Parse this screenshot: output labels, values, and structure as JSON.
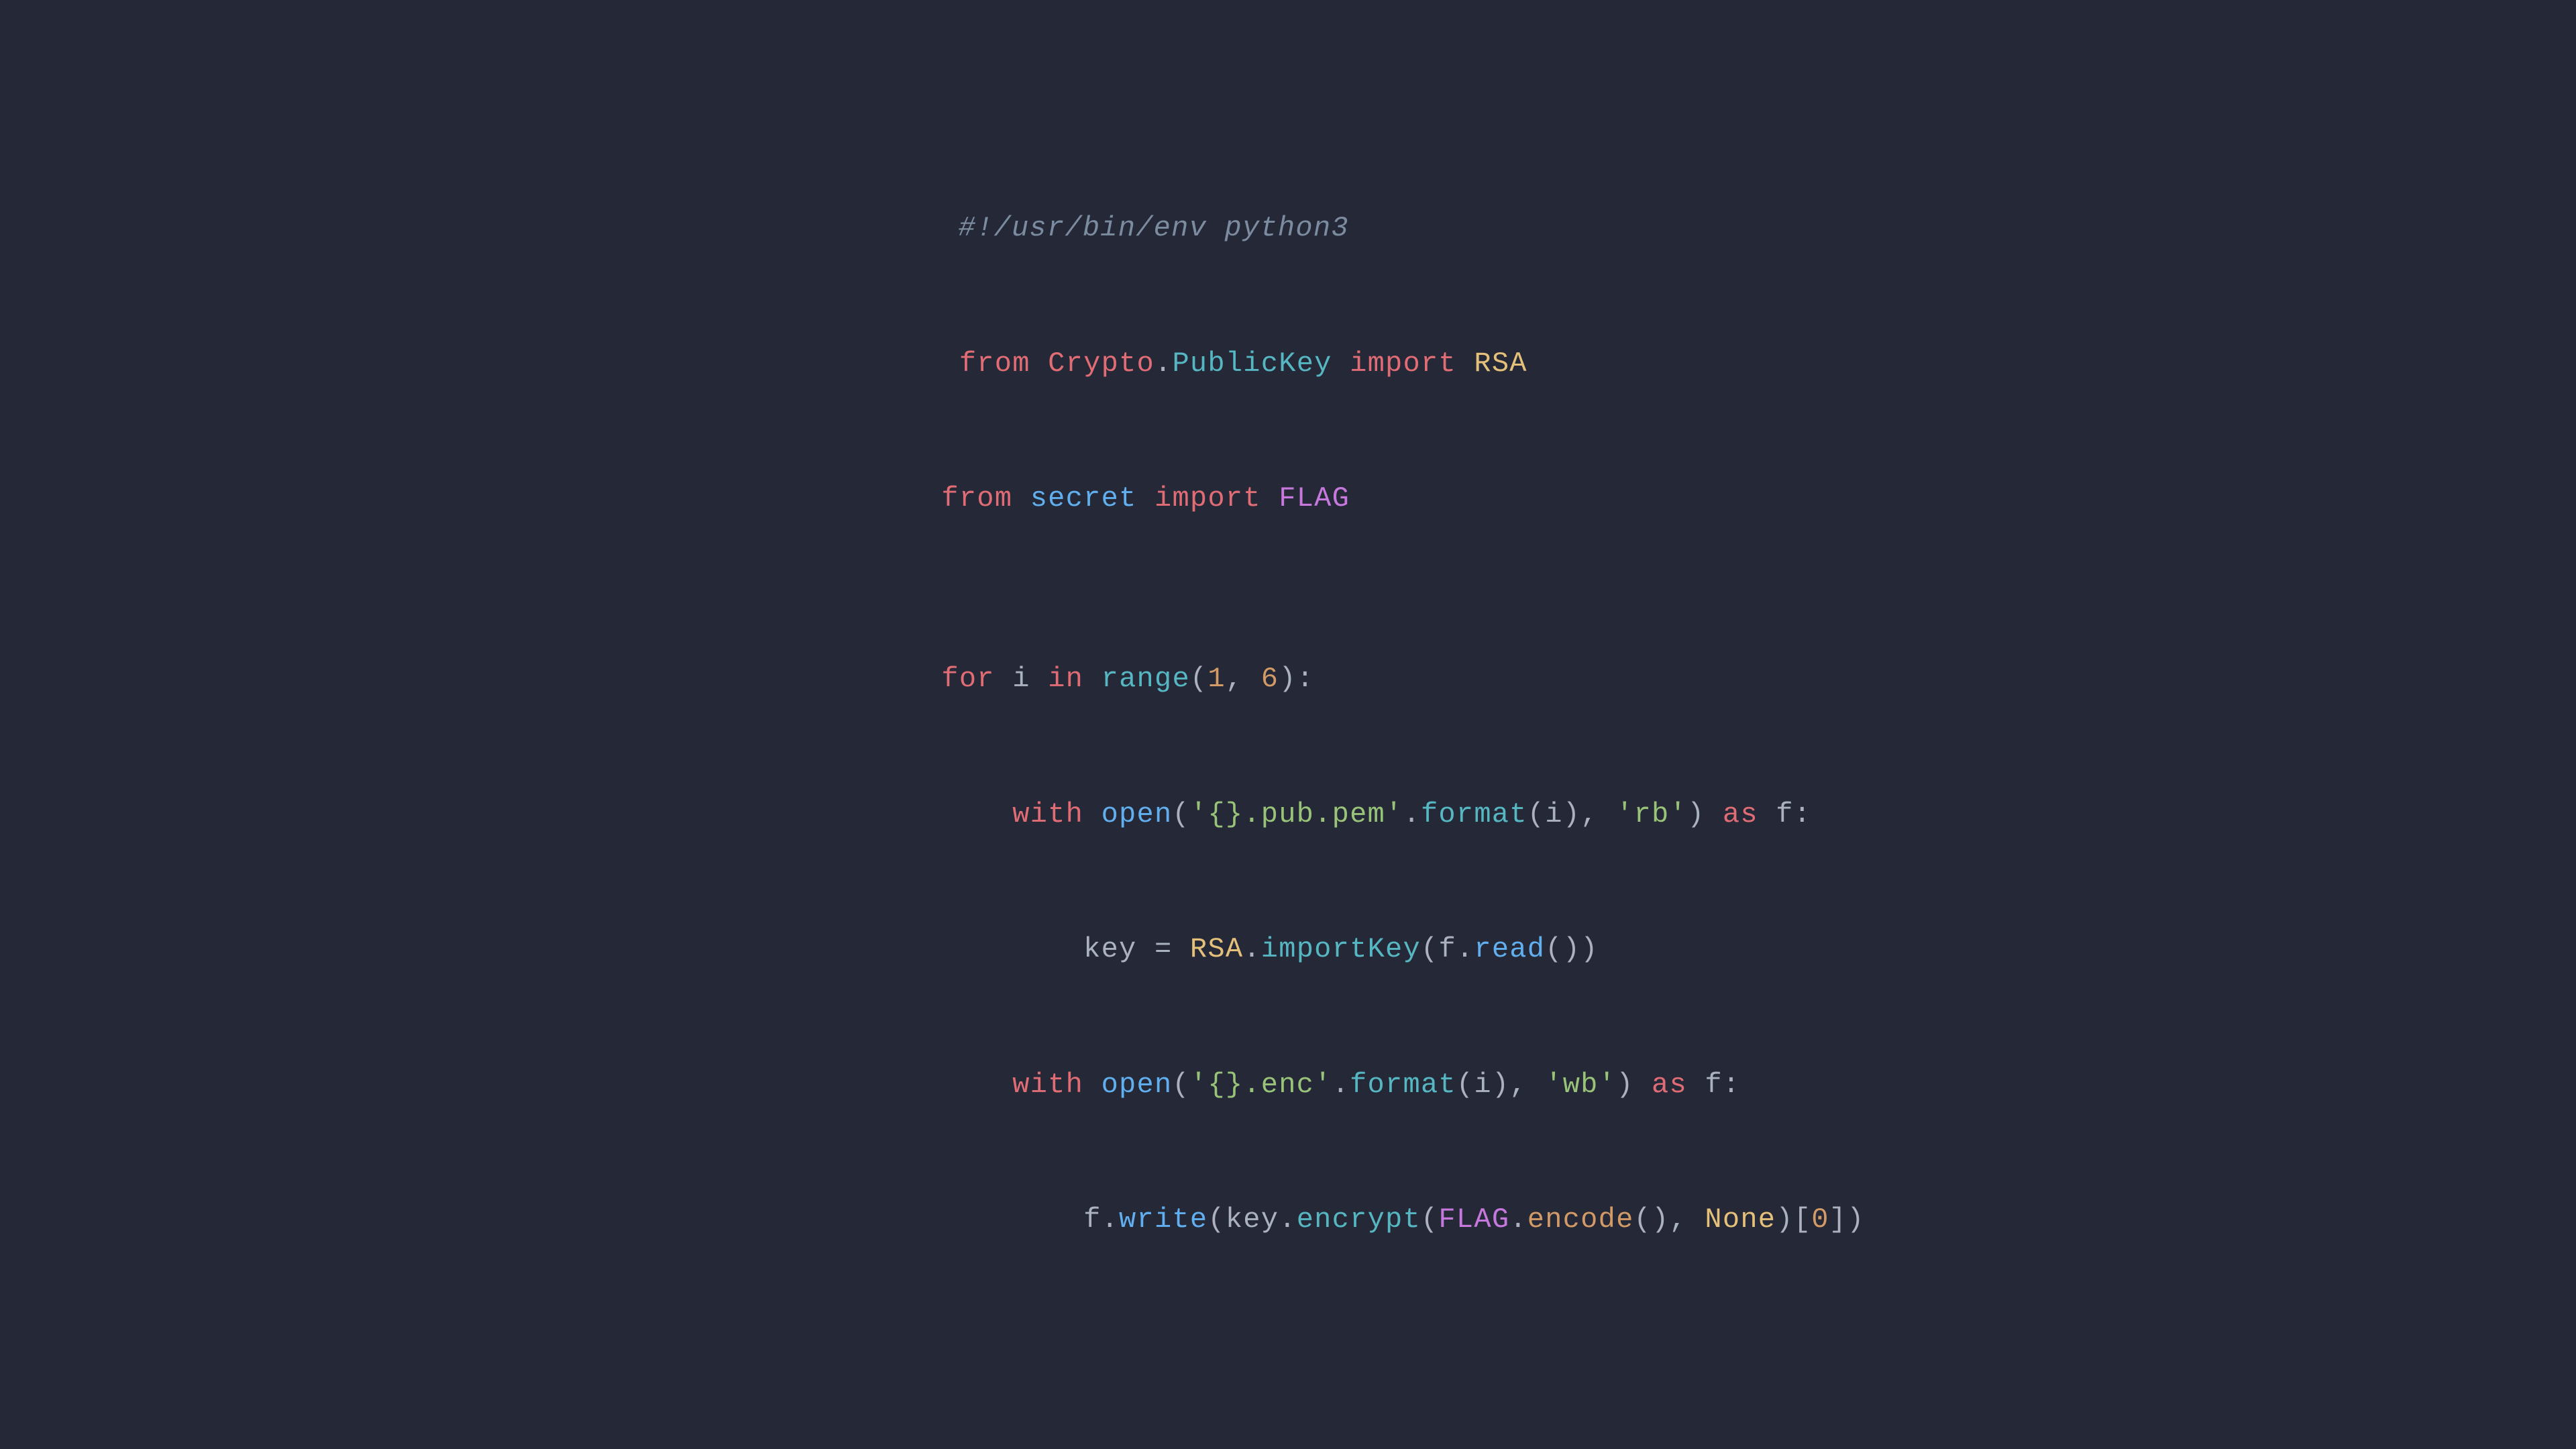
{
  "background": "#252836",
  "code": {
    "lines": [
      {
        "id": "shebang",
        "text": "#!/usr/bin/env python3"
      },
      {
        "id": "import1",
        "text": "from Crypto.PublicKey import RSA"
      },
      {
        "id": "import2",
        "text": "from secret import FLAG"
      },
      {
        "id": "empty1",
        "text": ""
      },
      {
        "id": "forloop",
        "text": "for i in range(1, 6):"
      },
      {
        "id": "with1",
        "text": "    with open('{}.pub.pem'.format(i), 'rb') as f:"
      },
      {
        "id": "keyline",
        "text": "        key = RSA.importKey(f.read())"
      },
      {
        "id": "with2",
        "text": "    with open('{}.enc'.format(i), 'wb') as f:"
      },
      {
        "id": "writeline",
        "text": "        f.write(key.encrypt(FLAG.encode(), None)[0])"
      }
    ]
  }
}
